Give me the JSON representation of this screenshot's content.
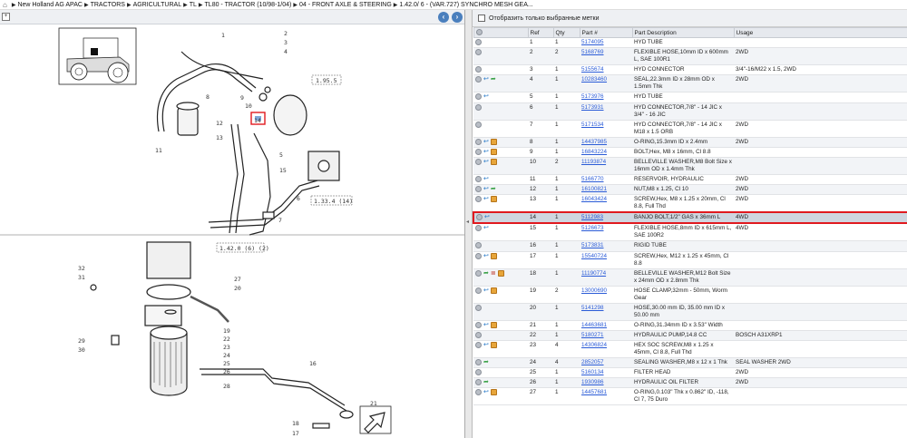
{
  "breadcrumb": [
    "New Holland AG APAC",
    "TRACTORS",
    "AGRICULTURAL",
    "TL",
    "TL80 - TRACTOR (10/98-1/04)",
    "04 - FRONT AXLE & STEERING",
    "1.42.0/ 6 - (VAR.727) SYNCHRO MESH GEA..."
  ],
  "diagram": {
    "callouts": [
      "1",
      "2",
      "3",
      "4",
      "5",
      "6",
      "7",
      "8",
      "9",
      "10",
      "11",
      "12",
      "13",
      "14",
      "15",
      "16",
      "17",
      "18",
      "19",
      "20",
      "21",
      "22",
      "23",
      "24",
      "25",
      "26",
      "27",
      "28",
      "29",
      "30",
      "31",
      "32"
    ],
    "refs": [
      "1.95.5",
      "1.33.4 (14)",
      "1.42.0 (6)  (2)"
    ]
  },
  "filter_label": "Отобразить только выбранные метки",
  "columns": [
    "Ref",
    "Qty",
    "Part #",
    "Part Description",
    "Usage"
  ],
  "rows": [
    {
      "ref": "1",
      "qty": "1",
      "part": "5174095",
      "desc": "HYD TUBE",
      "usage": "",
      "icons": [
        "info"
      ]
    },
    {
      "ref": "2",
      "qty": "2",
      "part": "5168769",
      "desc": "FLEXIBLE HOSE,10mm ID x 600mm L, SAE 100R1",
      "usage": "2WD",
      "icons": [
        "info"
      ]
    },
    {
      "ref": "3",
      "qty": "1",
      "part": "5155674",
      "desc": "HYD CONNECTOR",
      "usage": "3/4\"-16/M22 x 1.5, 2WD",
      "icons": [
        "info"
      ]
    },
    {
      "ref": "4",
      "qty": "1",
      "part": "10283460",
      "desc": "SEAL,22.3mm ID x 28mm OD x 1.5mm Thk",
      "usage": "2WD",
      "icons": [
        "info",
        "arrow",
        "green"
      ]
    },
    {
      "ref": "5",
      "qty": "1",
      "part": "5173976",
      "desc": "HYD TUBE",
      "usage": "",
      "icons": [
        "info",
        "arrow"
      ]
    },
    {
      "ref": "6",
      "qty": "1",
      "part": "5173931",
      "desc": "HYD CONNECTOR,7/8\" - 14 JIC x 3/4\" - 16 JIC",
      "usage": "",
      "icons": [
        "info"
      ]
    },
    {
      "ref": "7",
      "qty": "1",
      "part": "5171534",
      "desc": "HYD CONNECTOR,7/8\" - 14 JIC x M18 x 1.5 ORB",
      "usage": "2WD",
      "icons": [
        "info"
      ]
    },
    {
      "ref": "8",
      "qty": "1",
      "part": "14437985",
      "desc": "O-RING,15.3mm ID x 2.4mm",
      "usage": "2WD",
      "icons": [
        "info",
        "arrow",
        "cube"
      ]
    },
    {
      "ref": "9",
      "qty": "1",
      "part": "16843224",
      "desc": "BOLT,Hex, M8 x 16mm, Cl 8.8",
      "usage": "",
      "icons": [
        "info",
        "arrow",
        "cube"
      ]
    },
    {
      "ref": "10",
      "qty": "2",
      "part": "11193874",
      "desc": "BELLEVILLE WASHER,M8 Bolt Size x 16mm OD x 1.4mm Thk",
      "usage": "",
      "icons": [
        "info",
        "arrow",
        "cube"
      ]
    },
    {
      "ref": "11",
      "qty": "1",
      "part": "5166770",
      "desc": "RESERVOIR, HYDRAULIC",
      "usage": "2WD",
      "icons": [
        "info",
        "arrow"
      ]
    },
    {
      "ref": "12",
      "qty": "1",
      "part": "16100821",
      "desc": "NUT,M8 x 1.25, Cl 10",
      "usage": "2WD",
      "icons": [
        "info",
        "arrow",
        "green"
      ]
    },
    {
      "ref": "13",
      "qty": "1",
      "part": "16043424",
      "desc": "SCREW,Hex, M8 x 1.25 x 20mm, Cl 8.8, Full Thd",
      "usage": "2WD",
      "icons": [
        "info",
        "arrow",
        "cube"
      ]
    },
    {
      "ref": "14",
      "qty": "1",
      "part": "5112983",
      "desc": "BANJO BOLT,1/2\" GAS x 36mm L",
      "usage": "4WD",
      "icons": [
        "info",
        "arrow"
      ],
      "selected": true
    },
    {
      "ref": "15",
      "qty": "1",
      "part": "5126673",
      "desc": "FLEXIBLE HOSE,8mm ID x 615mm L, SAE 100R2",
      "usage": "4WD",
      "icons": [
        "info",
        "arrow"
      ]
    },
    {
      "ref": "16",
      "qty": "1",
      "part": "5173831",
      "desc": "RIGID TUBE",
      "usage": "",
      "icons": [
        "info"
      ]
    },
    {
      "ref": "17",
      "qty": "1",
      "part": "15540724",
      "desc": "SCREW,Hex, M12 x 1.25 x 45mm, Cl 8.8",
      "usage": "",
      "icons": [
        "info",
        "arrow",
        "cube"
      ]
    },
    {
      "ref": "18",
      "qty": "1",
      "part": "11190774",
      "desc": "BELLEVILLE WASHER,M12 Bolt Size x 24mm OD x 2.8mm Thk",
      "usage": "",
      "icons": [
        "info",
        "green",
        "doc",
        "cube"
      ]
    },
    {
      "ref": "19",
      "qty": "2",
      "part": "13000690",
      "desc": "HOSE CLAMP,32mm - 50mm, Worm Gear",
      "usage": "",
      "icons": [
        "info",
        "arrow",
        "cube"
      ]
    },
    {
      "ref": "20",
      "qty": "1",
      "part": "5141298",
      "desc": "HOSE,30.00 mm ID, 35.00 mm ID x 50.00 mm",
      "usage": "",
      "icons": [
        "info"
      ]
    },
    {
      "ref": "21",
      "qty": "1",
      "part": "14463681",
      "desc": "O-RING,31.34mm ID x 3.53\" Width",
      "usage": "",
      "icons": [
        "info",
        "arrow",
        "cube"
      ]
    },
    {
      "ref": "22",
      "qty": "1",
      "part": "5180271",
      "desc": "HYDRAULIC PUMP,14.8 CC",
      "usage": "BOSCH A31XRP1",
      "icons": [
        "info"
      ]
    },
    {
      "ref": "23",
      "qty": "4",
      "part": "14306824",
      "desc": "HEX SOC SCREW,M8 x 1.25 x 45mm, Cl 8.8, Full Thd",
      "usage": "",
      "icons": [
        "info",
        "arrow",
        "cube"
      ]
    },
    {
      "ref": "24",
      "qty": "4",
      "part": "2852057",
      "desc": "SEALING WASHER,M8 x 12 x 1 Thk",
      "usage": "SEAL WASHER 2WD",
      "icons": [
        "info",
        "green"
      ]
    },
    {
      "ref": "25",
      "qty": "1",
      "part": "5160134",
      "desc": "FILTER HEAD",
      "usage": "2WD",
      "icons": [
        "info"
      ]
    },
    {
      "ref": "26",
      "qty": "1",
      "part": "1930986",
      "desc": "HYDRAULIC OIL FILTER",
      "usage": "2WD",
      "icons": [
        "info",
        "green"
      ]
    },
    {
      "ref": "27",
      "qty": "1",
      "part": "14457681",
      "desc": "O-RING,0.103\" Thk x 0.862\" ID, -118, Cl 7, 75 Duro",
      "usage": "",
      "icons": [
        "info",
        "arrow",
        "cube"
      ]
    }
  ],
  "colors": {
    "accent": "#2a5bd7",
    "selected_border": "#e0191f",
    "highlight_box": "#e0191f"
  }
}
